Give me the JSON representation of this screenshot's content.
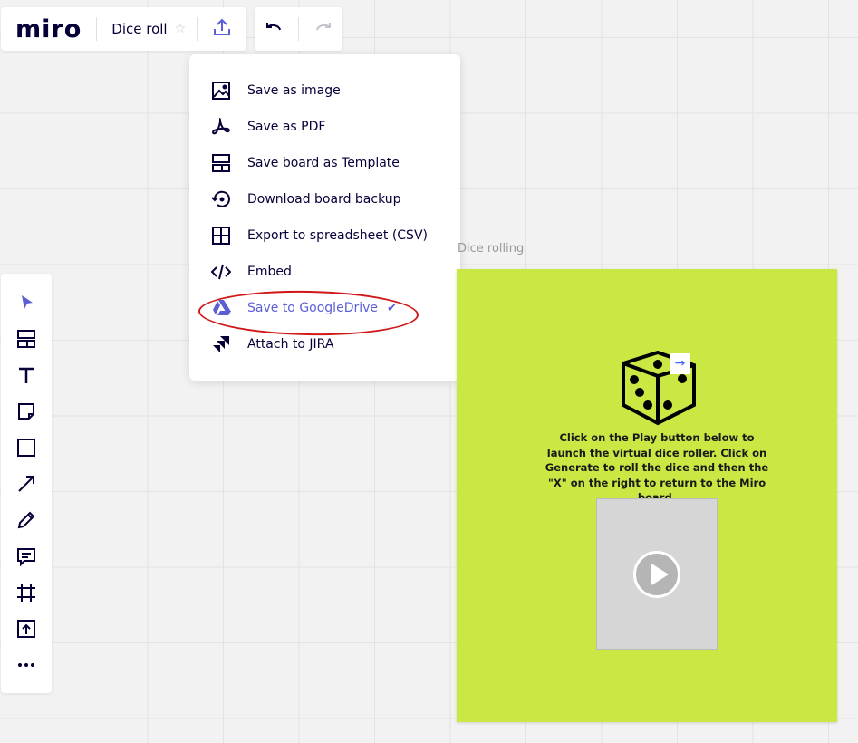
{
  "header": {
    "logo": "miro",
    "board_title": "Dice roll"
  },
  "export_menu": {
    "items": [
      {
        "label": "Save as image",
        "icon": "image-icon"
      },
      {
        "label": "Save as PDF",
        "icon": "pdf-icon"
      },
      {
        "label": "Save board as Template",
        "icon": "template-icon"
      },
      {
        "label": "Download board backup",
        "icon": "backup-icon"
      },
      {
        "label": "Export to spreadsheet (CSV)",
        "icon": "table-icon"
      },
      {
        "label": "Embed",
        "icon": "code-icon"
      },
      {
        "label": "Save to GoogleDrive",
        "icon": "google-drive-icon",
        "active": true
      },
      {
        "label": "Attach to JIRA",
        "icon": "jira-icon"
      }
    ],
    "accent": "#5b5fd6",
    "annotation_color": "#d01818"
  },
  "toolbar": {
    "tools": [
      "select",
      "templates",
      "text",
      "sticky-note",
      "shape",
      "line",
      "pen",
      "comment",
      "frame",
      "upload",
      "more"
    ],
    "active": "select"
  },
  "frame": {
    "label": "Dice rolling",
    "background": "#c9e843",
    "description": "Click on the Play button below to launch the virtual dice roller. Click on Generate to roll the dice and then the \"X\" on the right to return to the Miro board."
  }
}
